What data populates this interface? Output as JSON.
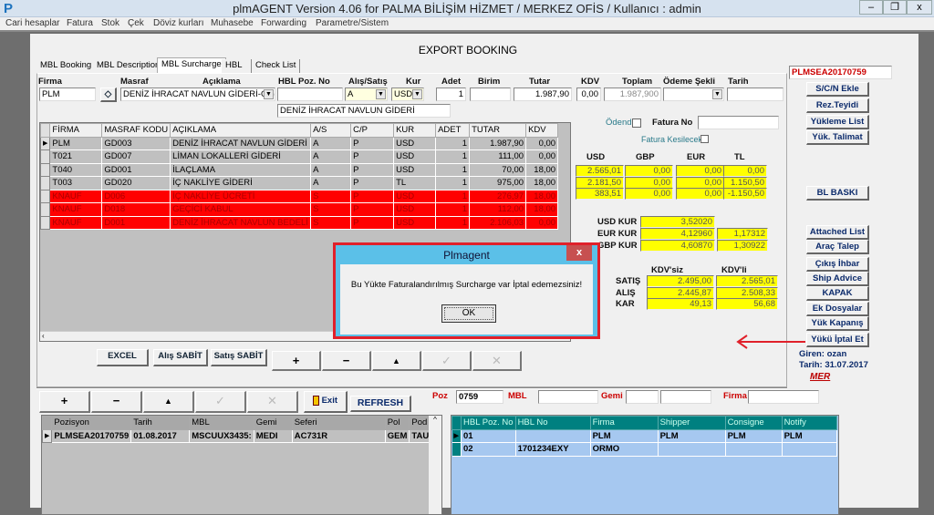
{
  "window": {
    "title": "plmAGENT  Version 4.06 for  PALMA BİLİŞİM HİZMET  /  MERKEZ OFİS /     Kullanıcı : admin",
    "icon": "P",
    "minimize": "–",
    "restore": "❐",
    "close": "x"
  },
  "menu": [
    "Cari hesaplar",
    "Fatura",
    "Stok",
    "Çek",
    "Döviz kurları",
    "Muhasebe",
    "Forwarding",
    "Parametre/Sistem"
  ],
  "form": {
    "title": "EXPORT BOOKING",
    "tabs": [
      "MBL Booking",
      "MBL Description",
      "MBL Surcharge",
      "HBL",
      "Check List"
    ],
    "labels": {
      "firma": "Firma",
      "masraf": "Masraf",
      "aciklama": "Açıklama",
      "hbl_poz": "HBL Poz. No",
      "alis_satis": "Alış/Satış",
      "kur": "Kur",
      "adet": "Adet",
      "birim": "Birim",
      "tutar": "Tutar",
      "kdv": "KDV",
      "toplam": "Toplam",
      "odeme": "Ödeme Şekli",
      "tarih": "Tarih"
    },
    "values": {
      "firma": "PLM",
      "masraf": "DENİZ İHRACAT NAVLUN GİDERİ-GD(",
      "hbl_poz": "",
      "alis_satis": "A",
      "kur": "USD",
      "adet": "1",
      "birim": "",
      "tutar": "1.987,90",
      "kdv": "0,00",
      "toplam": "1.987,900",
      "odeme": "",
      "tarih": "",
      "aciklama": "DENİZ İHRACAT NAVLUN GİDERİ"
    },
    "grid": {
      "columns": [
        "FİRMA",
        "MASRAF KODU",
        "AÇIKLAMA",
        "A/S",
        "C/P",
        "KUR",
        "ADET",
        "TUTAR",
        "KDV"
      ],
      "rows": [
        [
          "PLM",
          "GD003",
          "DENİZ İHRACAT NAVLUN GİDERİ",
          "A",
          "P",
          "USD",
          "1",
          "1.987,90",
          "0,00"
        ],
        [
          "T021",
          "GD007",
          "LİMAN LOKALLERİ GİDERİ",
          "A",
          "P",
          "USD",
          "1",
          "111,00",
          "0,00"
        ],
        [
          "T040",
          "GD001",
          "İLAÇLAMA",
          "A",
          "P",
          "USD",
          "1",
          "70,00",
          "18,00"
        ],
        [
          "T003",
          "GD020",
          "İÇ NAKLİYE GİDERİ",
          "A",
          "P",
          "TL",
          "1",
          "975,00",
          "18,00"
        ],
        [
          "KNAUF",
          "D006",
          "İÇ NAKLİYE ÜCRETİ",
          "S",
          "P",
          "USD",
          "1",
          "276,97",
          "18,00"
        ],
        [
          "KNAUF",
          "D018",
          "GEÇİCİ KABUL",
          "S",
          "P",
          "USD",
          "1",
          "112,00",
          "18,00"
        ],
        [
          "KNAUF",
          "D001",
          "DENİZ İHRACAT NAVLUN BEDELİ",
          "S",
          "P",
          "USD",
          "1",
          "2.106,03",
          "0,00"
        ]
      ],
      "highlight_color": "#ff0000"
    },
    "odendi": "Ödendi",
    "fatura_no": "Fatura No",
    "fatura_kesilecek": "Fatura Kesilecek",
    "currency_headers": [
      "USD",
      "GBP",
      "EUR",
      "TL"
    ],
    "currency_rows": [
      [
        "2.565,01",
        "0,00",
        "0,00",
        "0,00"
      ],
      [
        "2.181,50",
        "0,00",
        "0,00",
        "1.150,50"
      ],
      [
        "383,51",
        "0,00",
        "0,00",
        "-1.150,50"
      ]
    ],
    "kur": [
      {
        "label": "USD KUR",
        "v1": "3,52020",
        "v2": null
      },
      {
        "label": "EUR KUR",
        "v1": "4,12960",
        "v2": "1,17312"
      },
      {
        "label": "GBP KUR",
        "v1": "4,60870",
        "v2": "1,30922"
      }
    ],
    "kdv_headers": [
      "KDV'siz",
      "KDV'li"
    ],
    "summary": [
      {
        "label": "SATIŞ",
        "a": "2.495,00",
        "b": "2.565,01"
      },
      {
        "label": "ALIŞ",
        "a": "2.445,87",
        "b": "2.508,33"
      },
      {
        "label": "KAR",
        "a": "49,13",
        "b": "56,68"
      }
    ],
    "buttons": {
      "excel": "EXCEL",
      "alis_sabit": "Alış SABİT",
      "satis_sabit": "Satış SABİT"
    },
    "nav": [
      "+",
      "−",
      "▲",
      "✓",
      "✕"
    ],
    "pozisyon": "PLMSEA20170759",
    "side_buttons": [
      "S/C/N Ekle",
      "Rez.Teyidi",
      "Yükleme List",
      "Yük. Talimat",
      "BL BASKI",
      "Attached List",
      "Araç Talep",
      "Çıkış İhbar",
      "Ship Advice",
      "KAPAK",
      "Ek Dosyalar",
      "Yük Kapanış",
      "Yükü İptal Et"
    ],
    "giren": "Giren:  ozan",
    "tarih_info": "Tarih:  31.07.2017",
    "logo": "MER",
    "exit": "Exit",
    "refresh": "REFRESH",
    "search": {
      "poz_label": "Poz",
      "poz": "0759",
      "mbl_label": "MBL",
      "mbl": "",
      "gemi_label": "Gemi",
      "gemi1": "",
      "gemi2": "",
      "firma_label": "Firma",
      "firma": ""
    },
    "pos_grid": {
      "columns": [
        "Pozisyon",
        "Tarih",
        "MBL",
        "Gemi",
        "Seferi",
        "Pol",
        "Pod"
      ],
      "rows": [
        [
          "PLMSEA20170759",
          "01.08.2017",
          "MSCUUX3435:",
          "MEDI",
          "AC731R",
          "GEM",
          "TAU"
        ]
      ]
    },
    "hbl_grid": {
      "columns": [
        "HBL Poz. No",
        "HBL No",
        "Firma",
        "Shipper",
        "Consigne",
        "Notify"
      ],
      "rows": [
        [
          "01",
          "",
          "PLM",
          "PLM",
          "PLM",
          "PLM"
        ],
        [
          "02",
          "1701234EXY",
          "ORMO",
          "",
          "",
          ""
        ]
      ]
    }
  },
  "dialog": {
    "title": "Plmagent",
    "message": "Bu Yükte Faturalandırılmış  Surcharge var  İptal edemezsiniz!",
    "ok": "OK",
    "close": "x"
  },
  "colors": {
    "highlight": "#ff0000",
    "yellow": "#ffff00",
    "teal": "#008080",
    "annotation": "#e0202a"
  }
}
